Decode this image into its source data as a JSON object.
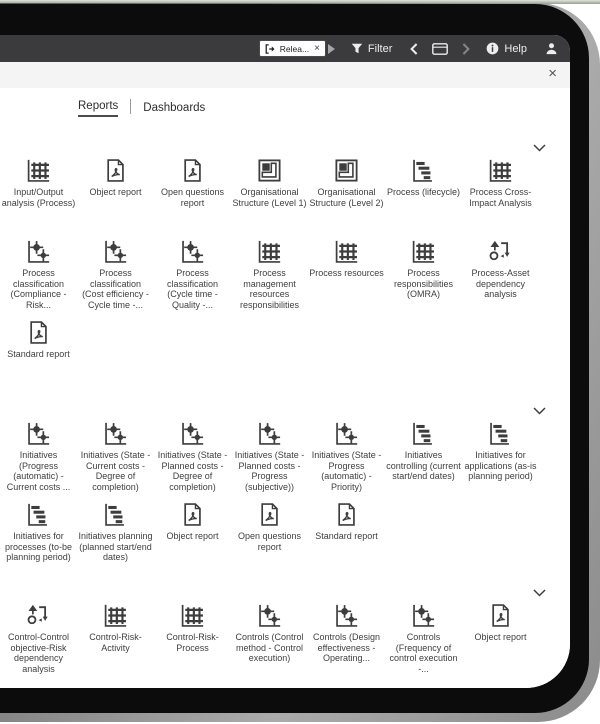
{
  "toolbar": {
    "tab_label": "Relea...",
    "tab_close": "×",
    "filter_label": "Filter",
    "help_label": "Help"
  },
  "panel": {
    "close_label": "×",
    "tabs": [
      {
        "label": "Reports",
        "active": true
      },
      {
        "label": "Dashboards",
        "active": false
      }
    ]
  },
  "colors": {
    "toolbar_bg": "#3b3b3d",
    "bezel": "#0c0c0c",
    "panel_header_bg": "#f4f4f4",
    "icon": "#3d3d3d",
    "label_text": "#3f3f3f"
  },
  "sections": [
    {
      "name": "process-reports",
      "items": [
        {
          "icon": "grid-chart-icon",
          "label": "Input/Output analysis (Process)"
        },
        {
          "icon": "pdf-icon",
          "label": "Object report"
        },
        {
          "icon": "pdf-icon",
          "label": "Open questions report"
        },
        {
          "icon": "org-structure-icon",
          "label": "Organisational Structure (Level 1)"
        },
        {
          "icon": "org-structure-icon",
          "label": "Organisational Structure (Level 2)"
        },
        {
          "icon": "gantt-icon",
          "label": "Process (lifecycle)"
        },
        {
          "icon": "grid-chart-icon",
          "label": "Process Cross-Impact Analysis"
        },
        {
          "icon": "scatter-icon",
          "label": "Process classification (Compliance - Risk..."
        },
        {
          "icon": "scatter-icon",
          "label": "Process classification (Cost efficiency - Cycle time -..."
        },
        {
          "icon": "scatter-icon",
          "label": "Process classification (Cycle time - Quality -..."
        },
        {
          "icon": "grid-chart-icon",
          "label": "Process management resources responsibilities"
        },
        {
          "icon": "grid-chart-icon",
          "label": "Process resources"
        },
        {
          "icon": "grid-chart-icon",
          "label": "Process responsibilities (OMRA)"
        },
        {
          "icon": "dependency-icon",
          "label": "Process-Asset dependency analysis"
        },
        {
          "icon": "pdf-icon",
          "label": "Standard report"
        }
      ]
    },
    {
      "name": "initiative-reports",
      "items": [
        {
          "icon": "scatter-icon",
          "label": "Initiatives (Progress (automatic) - Current costs ..."
        },
        {
          "icon": "scatter-icon",
          "label": "Initiatives (State - Current costs - Degree of completion)"
        },
        {
          "icon": "scatter-icon",
          "label": "Initiatives (State - Planned costs - Degree of completion)"
        },
        {
          "icon": "scatter-icon",
          "label": "Initiatives (State - Planned costs - Progress (subjective))"
        },
        {
          "icon": "scatter-icon",
          "label": "Initiatives (State - Progress (automatic) - Priority)"
        },
        {
          "icon": "gantt-icon",
          "label": "Initiatives controlling (current start/end dates)"
        },
        {
          "icon": "gantt-icon",
          "label": "Initiatives for applications (as-is planning period)"
        },
        {
          "icon": "gantt-icon",
          "label": "Initiatives for processes (to-be planning period)"
        },
        {
          "icon": "gantt-icon",
          "label": "Initiatives planning (planned start/end dates)"
        },
        {
          "icon": "pdf-icon",
          "label": "Object report"
        },
        {
          "icon": "pdf-icon",
          "label": "Open questions report"
        },
        {
          "icon": "pdf-icon",
          "label": "Standard report"
        }
      ]
    },
    {
      "name": "control-reports",
      "items": [
        {
          "icon": "dependency-icon",
          "label": "Control-Control objective-Risk dependency analysis"
        },
        {
          "icon": "grid-chart-icon",
          "label": "Control-Risk-Activity"
        },
        {
          "icon": "grid-chart-icon",
          "label": "Control-Risk-Process"
        },
        {
          "icon": "scatter-icon",
          "label": "Controls (Control method - Control execution)"
        },
        {
          "icon": "scatter-icon",
          "label": "Controls (Design effectiveness - Operating..."
        },
        {
          "icon": "scatter-icon",
          "label": "Controls (Frequency of control execution -..."
        },
        {
          "icon": "pdf-icon",
          "label": "Object report"
        }
      ]
    }
  ]
}
